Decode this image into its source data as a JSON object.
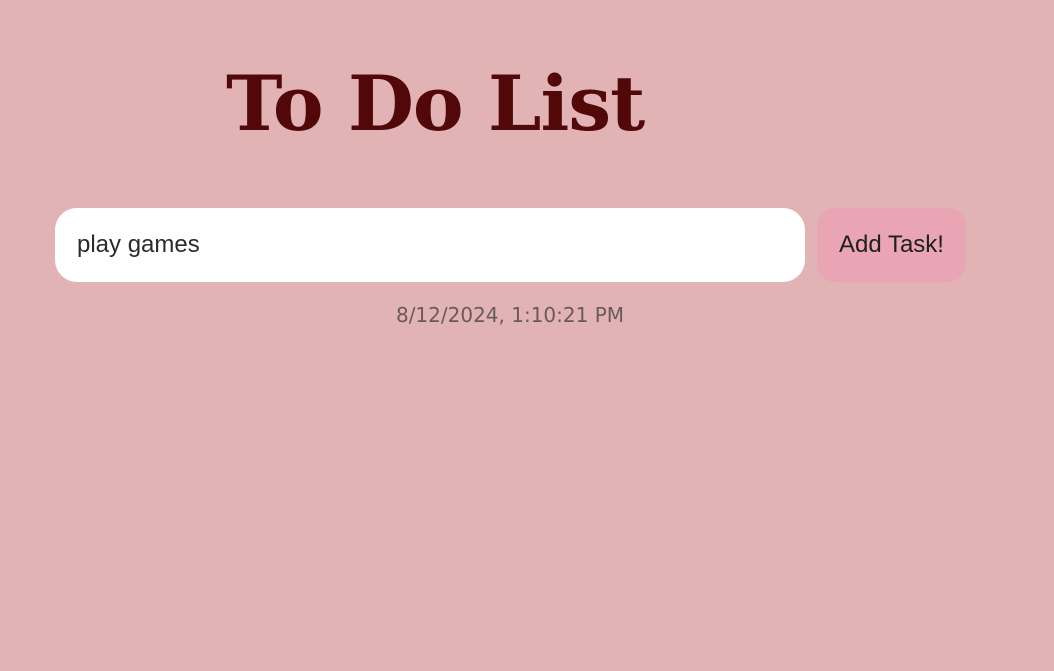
{
  "header": {
    "title": "To Do List"
  },
  "form": {
    "task_input_value": "play games",
    "add_button_label": "Add Task!"
  },
  "clock": {
    "timestamp": "8/12/2024, 1:10:21 PM"
  },
  "colors": {
    "background": "#e1b3b5",
    "title": "#520808",
    "button": "#eaa5b5",
    "input": "#ffffff"
  },
  "tasks": []
}
